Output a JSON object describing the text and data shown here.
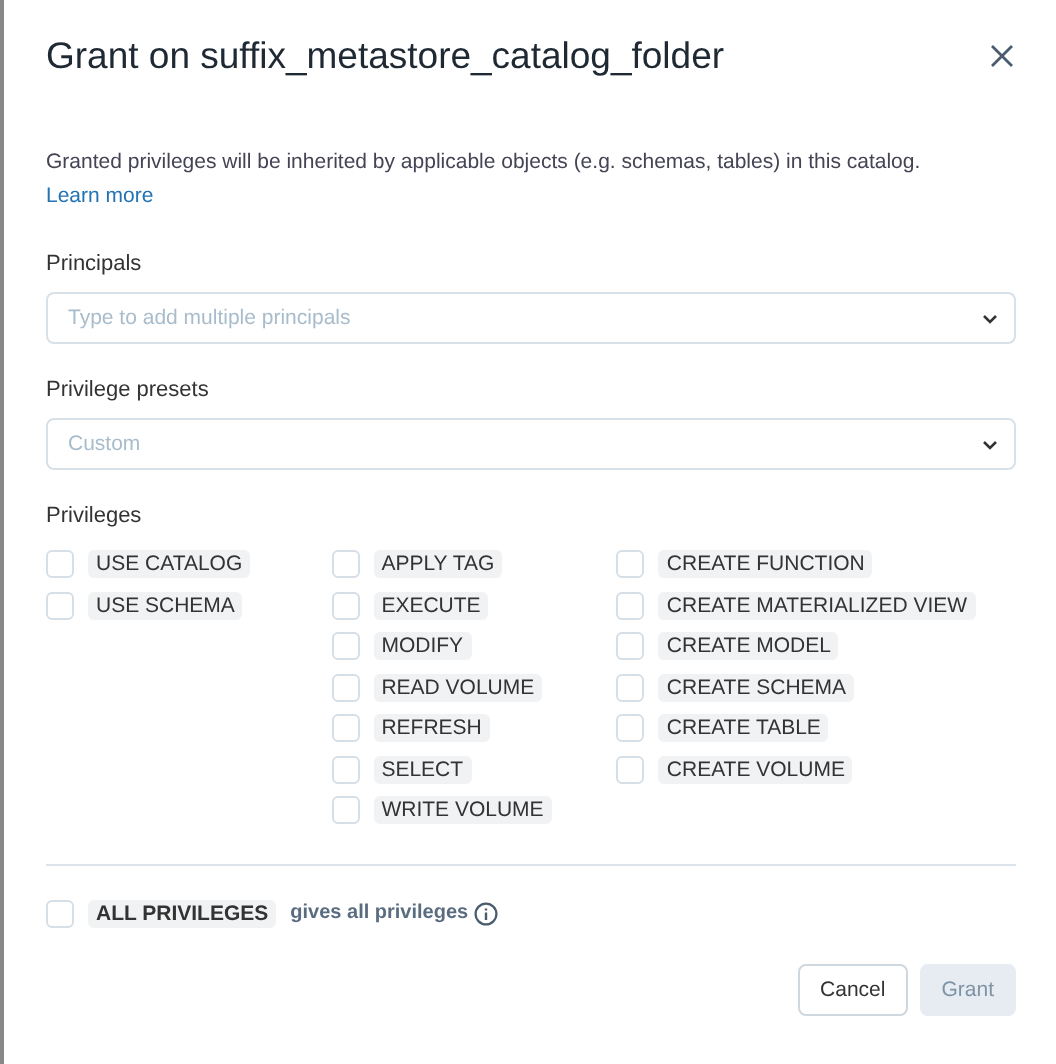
{
  "dialog": {
    "title": "Grant on suffix_metastore_catalog_folder",
    "description": "Granted privileges will be inherited by applicable objects (e.g. schemas, tables) in this catalog.",
    "learn_more_link": "Learn more"
  },
  "principals": {
    "label": "Principals",
    "placeholder": "Type to add multiple principals"
  },
  "presets": {
    "label": "Privilege presets",
    "placeholder": "Custom"
  },
  "privileges": {
    "label": "Privileges",
    "columns": [
      [
        {
          "name": "USE CATALOG",
          "checked": false
        },
        {
          "name": "USE SCHEMA",
          "checked": false
        }
      ],
      [
        {
          "name": "APPLY TAG",
          "checked": false
        },
        {
          "name": "EXECUTE",
          "checked": false
        },
        {
          "name": "MODIFY",
          "checked": false
        },
        {
          "name": "READ VOLUME",
          "checked": false
        },
        {
          "name": "REFRESH",
          "checked": false
        },
        {
          "name": "SELECT",
          "checked": false
        },
        {
          "name": "WRITE VOLUME",
          "checked": false
        }
      ],
      [
        {
          "name": "CREATE FUNCTION",
          "checked": false
        },
        {
          "name": "CREATE MATERIALIZED VIEW",
          "checked": false
        },
        {
          "name": "CREATE MODEL",
          "checked": false
        },
        {
          "name": "CREATE SCHEMA",
          "checked": false
        },
        {
          "name": "CREATE TABLE",
          "checked": false
        },
        {
          "name": "CREATE VOLUME",
          "checked": false
        }
      ]
    ]
  },
  "all_privileges": {
    "name": "ALL PRIVILEGES",
    "checked": false,
    "hint": "gives all privileges"
  },
  "buttons": [
    {
      "label": "Cancel",
      "disabled": false
    },
    {
      "label": "Grant",
      "disabled": true
    }
  ]
}
